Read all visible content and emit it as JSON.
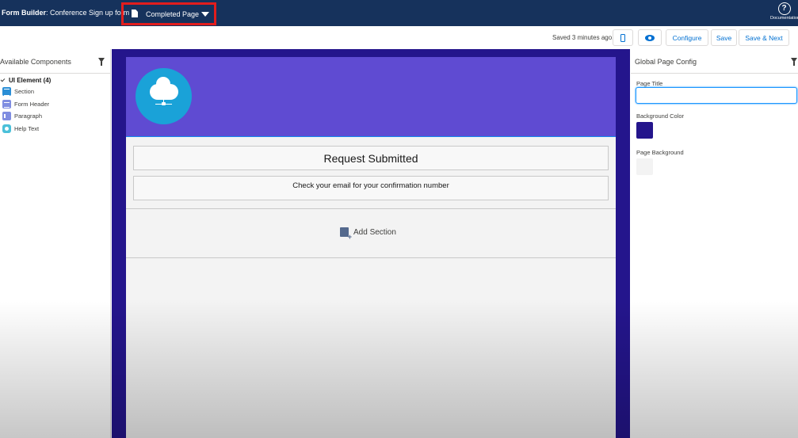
{
  "topbar": {
    "app_prefix": "Form Builder",
    "form_name": ": Conference Sign up form",
    "page_selector_label": "Completed Page",
    "documentation_label": "Documentation"
  },
  "toolbar": {
    "saved_status": "Saved 3 minutes ago.",
    "configure_label": "Configure",
    "save_label": "Save",
    "save_next_label": "Save & Next"
  },
  "left_panel": {
    "title": "Available Components",
    "group_label": "UI Element (4)",
    "items": [
      {
        "label": "Section",
        "icon": "section-icon"
      },
      {
        "label": "Form Header",
        "icon": "form-header-icon"
      },
      {
        "label": "Paragraph",
        "icon": "paragraph-icon"
      },
      {
        "label": "Help Text",
        "icon": "help-text-icon"
      }
    ]
  },
  "canvas": {
    "title_text": "Request Submitted",
    "help_text": "Check your email for your confirmation number",
    "add_section_label": "Add Section",
    "header_color": "#5f4bd2",
    "logo_color": "#1aa2d8"
  },
  "right_panel": {
    "title": "Global Page Config",
    "page_title_label": "Page Title",
    "page_title_value": "",
    "background_color_label": "Background Color",
    "background_color_value": "#24158c",
    "page_background_label": "Page Background",
    "page_background_value": "#f3f3f3"
  },
  "colors": {
    "topbar": "#16325c",
    "accent": "#0070d2",
    "highlight": "#e21d1d"
  }
}
